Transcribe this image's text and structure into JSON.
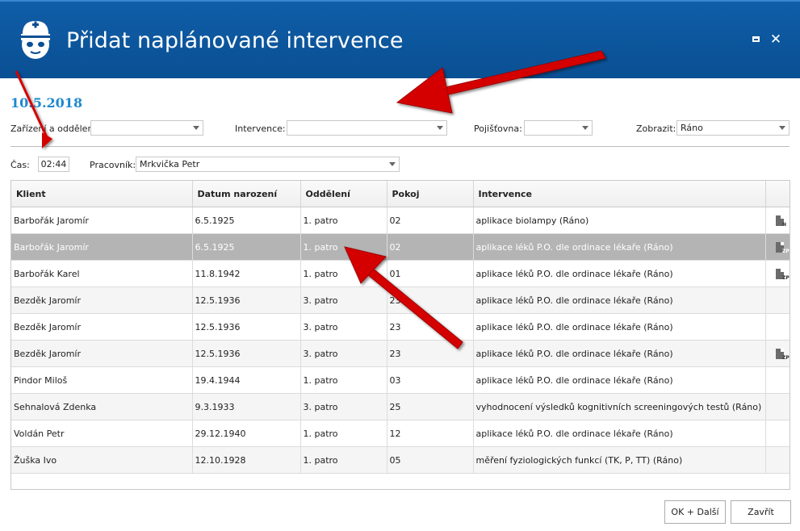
{
  "window": {
    "title": "Přidat naplánované intervence",
    "colors": {
      "titlebar": "#0a4f93",
      "date": "#1e88d0",
      "selected_row": "#b4b4b4",
      "arrow": "#d40000"
    }
  },
  "date": "10.5.2018",
  "filters": {
    "zarizeni_label": "Zařízení a oddělení:",
    "zarizeni_value": "",
    "intervence_label": "Intervence:",
    "intervence_value": "",
    "pojistovna_label": "Pojišťovna:",
    "pojistovna_value": "",
    "zobrazit_label": "Zobrazit:",
    "zobrazit_value": "Ráno"
  },
  "time": {
    "label": "Čas:",
    "value": "02:44"
  },
  "worker": {
    "label": "Pracovník:",
    "value": "Mrkvička Petr"
  },
  "table": {
    "columns": [
      "Klient",
      "Datum narození",
      "Oddělení",
      "Pokoj",
      "Intervence",
      ""
    ],
    "rows": [
      {
        "klient": "Barbořák Jaromír",
        "datum": "6.5.1925",
        "oddeleni": "1. patro",
        "pokoj": "02",
        "intervence": "aplikace biolampy (Ráno)",
        "icon": "N",
        "style": ""
      },
      {
        "klient": "Barbořák Jaromír",
        "datum": "6.5.1925",
        "oddeleni": "1. patro",
        "pokoj": "02",
        "intervence": "aplikace léků P.O. dle ordinace lékaře (Ráno)",
        "icon": "ZP",
        "style": "sel"
      },
      {
        "klient": "Barbořák Karel",
        "datum": "11.8.1942",
        "oddeleni": "1. patro",
        "pokoj": "01",
        "intervence": "aplikace léků P.O. dle ordinace lékaře (Ráno)",
        "icon": "ZP",
        "style": ""
      },
      {
        "klient": "Bezděk Jaromír",
        "datum": "12.5.1936",
        "oddeleni": "3. patro",
        "pokoj": "23",
        "intervence": "aplikace léků P.O. dle ordinace lékaře (Ráno)",
        "icon": "",
        "style": "alt"
      },
      {
        "klient": "Bezděk Jaromír",
        "datum": "12.5.1936",
        "oddeleni": "3. patro",
        "pokoj": "23",
        "intervence": "aplikace léků P.O. dle ordinace lékaře (Ráno)",
        "icon": "",
        "style": ""
      },
      {
        "klient": "Bezděk Jaromír",
        "datum": "12.5.1936",
        "oddeleni": "3. patro",
        "pokoj": "23",
        "intervence": "aplikace léků P.O. dle ordinace lékaře (Ráno)",
        "icon": "ZP",
        "style": "alt"
      },
      {
        "klient": "Pindor Miloš",
        "datum": "19.4.1944",
        "oddeleni": "1. patro",
        "pokoj": "03",
        "intervence": "aplikace léků P.O. dle ordinace lékaře (Ráno)",
        "icon": "",
        "style": ""
      },
      {
        "klient": "Sehnalová Zdenka",
        "datum": "9.3.1933",
        "oddeleni": "3. patro",
        "pokoj": "25",
        "intervence": "vyhodnocení výsledků kognitivních screeningových testů (Ráno)",
        "icon": "",
        "style": "alt"
      },
      {
        "klient": "Voldán Petr",
        "datum": "29.12.1940",
        "oddeleni": "1. patro",
        "pokoj": "12",
        "intervence": "aplikace léků P.O. dle ordinace lékaře (Ráno)",
        "icon": "",
        "style": ""
      },
      {
        "klient": "Žuška Ivo",
        "datum": "12.10.1928",
        "oddeleni": "1. patro",
        "pokoj": "05",
        "intervence": "měření fyziologických funkcí (TK, P, TT) (Ráno)",
        "icon": "",
        "style": "alt"
      }
    ]
  },
  "buttons": {
    "ok_next": "OK + Další",
    "close": "Zavřít"
  },
  "icons": {
    "logo": "nurse-icon",
    "maximize": "maximize-icon",
    "close": "close-icon",
    "row": "document-icon"
  }
}
